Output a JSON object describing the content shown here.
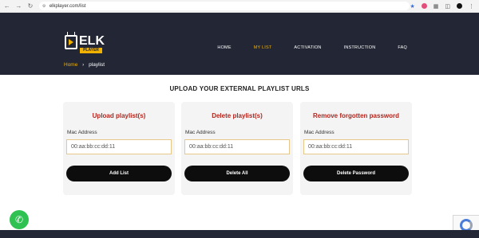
{
  "browser": {
    "url": "elkplayer.com/list"
  },
  "header": {
    "logo_text": "ELK",
    "logo_sub": "PLAYER",
    "nav": [
      {
        "label": "HOME",
        "active": false
      },
      {
        "label": "MY LIST",
        "active": true
      },
      {
        "label": "ACTIVATION",
        "active": false
      },
      {
        "label": "INSTRUCTION",
        "active": false
      },
      {
        "label": "FAQ",
        "active": false
      }
    ],
    "breadcrumb": {
      "home": "Home",
      "separator": "›",
      "current": "playlist"
    }
  },
  "main": {
    "section_title": "UPLOAD YOUR EXTERNAL PLAYLIST URLS",
    "cards": [
      {
        "title": "Upload playlist(s)",
        "label": "Mac Address",
        "placeholder": "00:aa:bb:cc:dd:11",
        "button": "Add List"
      },
      {
        "title": "Delete playlist(s)",
        "label": "Mac Address",
        "placeholder": "00:aa:bb:cc:dd:11",
        "button": "Delete All"
      },
      {
        "title": "Remove forgotten password",
        "label": "Mac Address",
        "placeholder": "00:aa:bb:cc:dd:11",
        "button": "Delete Password"
      }
    ]
  },
  "colors": {
    "header_bg": "#232634",
    "accent": "#f0b100",
    "card_title": "#b3261e",
    "button_bg": "#0d0d0d",
    "whatsapp": "#2fc152"
  },
  "icons": {
    "back": "back-arrow-icon",
    "forward": "forward-arrow-icon",
    "reload": "reload-icon",
    "whatsapp": "whatsapp-icon",
    "recaptcha": "recaptcha-icon"
  }
}
